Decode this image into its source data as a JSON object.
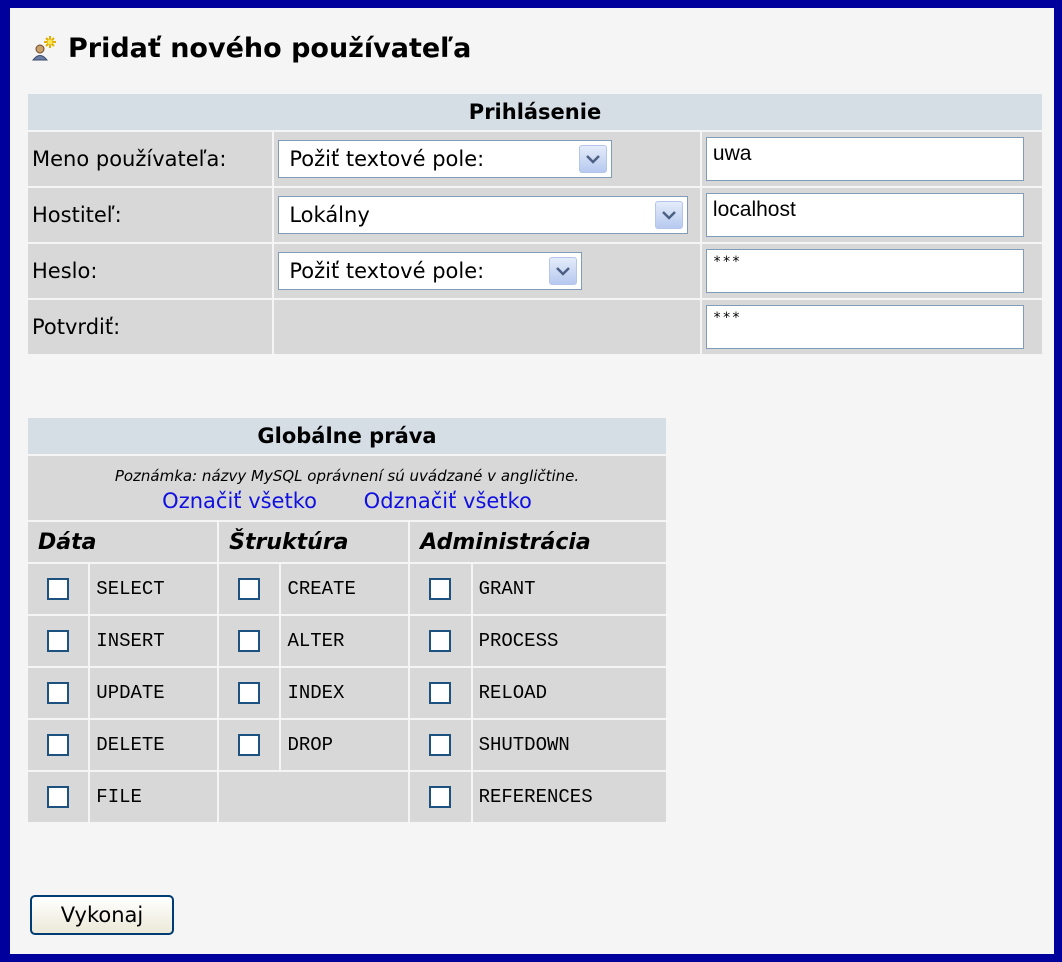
{
  "page": {
    "title": "Pridať nového používateľa"
  },
  "login": {
    "header": "Prihlásenie",
    "rows": [
      {
        "label": "Meno používateľa:",
        "select": "Požiť textové pole:",
        "value": "uwa"
      },
      {
        "label": "Hostiteľ:",
        "select": "Lokálny",
        "value": "localhost"
      },
      {
        "label": "Heslo:",
        "select": "Požiť textové pole:",
        "value": "***"
      },
      {
        "label": "Potvrdiť:",
        "value": "***"
      }
    ]
  },
  "privileges": {
    "header": "Globálne práva",
    "note": "Poznámka: názvy MySQL oprávnení sú uvádzané v angličtine.",
    "check_all": "Označiť všetko",
    "uncheck_all": "Odznačiť všetko",
    "groups": [
      "Dáta",
      "Štruktúra",
      "Administrácia"
    ],
    "data": [
      "SELECT",
      "INSERT",
      "UPDATE",
      "DELETE",
      "FILE"
    ],
    "structure": [
      "CREATE",
      "ALTER",
      "INDEX",
      "DROP"
    ],
    "admin": [
      "GRANT",
      "PROCESS",
      "RELOAD",
      "SHUTDOWN",
      "REFERENCES"
    ]
  },
  "submit_label": "Vykonaj",
  "colors": {
    "page_bg": "#00009c",
    "header_bg": "#d5dde5",
    "cell_bg": "#d8d8d8",
    "link": "#1010e0"
  }
}
